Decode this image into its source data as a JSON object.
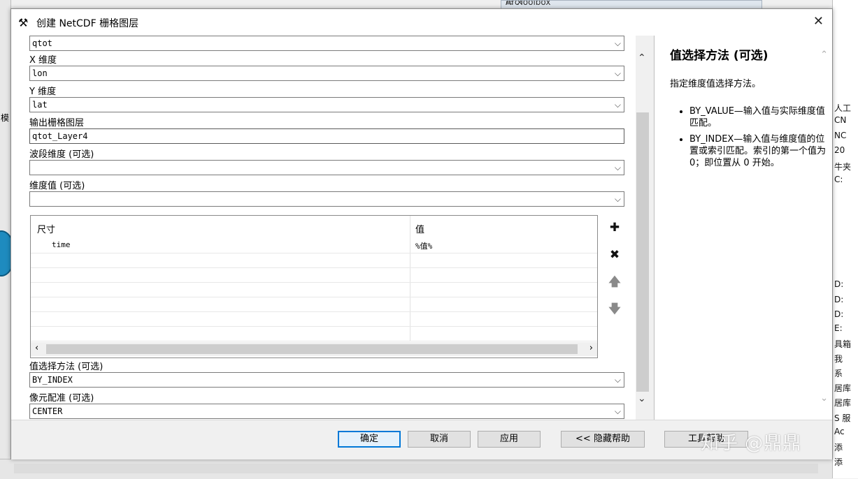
{
  "background": {
    "left_items": [
      "模"
    ],
    "toolbox_title": "ArcToolbox",
    "toolbox_buttons": "▭ ×",
    "right_items": [
      "人工",
      "CN",
      "NC",
      "20",
      "牛夹",
      "C:",
      "D:",
      "D:",
      "D:",
      "E:",
      "具箱",
      "我",
      "系",
      "居库",
      "居库",
      "S 服",
      "Ac",
      "添",
      "添"
    ]
  },
  "dialog": {
    "icon": "hammer-icon",
    "title": "创建 NetCDF 栅格图层",
    "close_glyph": "✕"
  },
  "params": {
    "variable": {
      "value": "qtot"
    },
    "x_dim": {
      "label": "X 维度",
      "value": "lon"
    },
    "y_dim": {
      "label": "Y 维度",
      "value": "lat"
    },
    "out_layer": {
      "label": "输出栅格图层",
      "value": "qtot_Layer4"
    },
    "band_dim": {
      "label": "波段维度 (可选)",
      "value": ""
    },
    "dim_values": {
      "label": "维度值 (可选)"
    },
    "value_selection": {
      "label": "值选择方法 (可选)",
      "value": "BY_INDEX"
    },
    "cell_registration": {
      "label": "像元配准 (可选)",
      "value": "CENTER"
    }
  },
  "grid": {
    "col1": "尺寸",
    "col2": "值",
    "rows": [
      {
        "dim": "time",
        "value": "%值%"
      }
    ]
  },
  "glyphs": {
    "dropdown": "⌵",
    "up": "⌃",
    "down": "⌄",
    "left": "‹",
    "right": "›"
  },
  "side_buttons": {
    "add": "✚",
    "delete": "✖",
    "move_up": "🡅",
    "move_down": "🡇"
  },
  "help": {
    "title": "值选择方法 (可选)",
    "description": "指定维度值选择方法。",
    "bullets": [
      "BY_VALUE—输入值与实际维度值匹配。",
      "BY_INDEX—输入值与维度值的位置或索引匹配。索引的第一个值为 0；即位置从 0 开始。"
    ]
  },
  "buttons": {
    "ok": "确定",
    "cancel": "取消",
    "apply": "应用",
    "hide_help": "<< 隐藏帮助",
    "tool_help": "工具帮助"
  },
  "watermark": "知乎 @鼎鼎"
}
